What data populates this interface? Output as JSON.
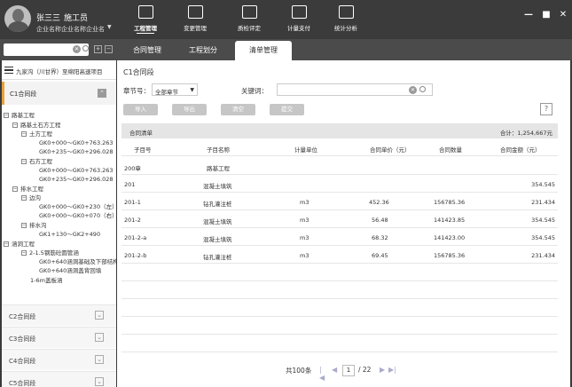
{
  "user": {
    "name": "张三三",
    "role": "施工员",
    "org": "企业名称企业名称企业名"
  },
  "topnav": [
    {
      "label": "工程管理",
      "icon": "project-icon",
      "active": true
    },
    {
      "label": "变更管理",
      "icon": "change-icon",
      "active": false
    },
    {
      "label": "质检评定",
      "icon": "quality-icon",
      "active": false
    },
    {
      "label": "计量支付",
      "icon": "payment-icon",
      "active": false
    },
    {
      "label": "统计分析",
      "icon": "stats-icon",
      "active": false
    }
  ],
  "subtabs": [
    "合同管理",
    "工程划分",
    "清单管理"
  ],
  "sidebar": {
    "project": "九家沟（川甘界）至绵阳高速项目",
    "active_contract": "C1合同段",
    "tree": [
      "路基工程",
      "路基土石方工程",
      "土方工程",
      "GK0+000～GK0+763.263",
      "GK0+235～GK0+296.028",
      "石方工程",
      "GK0+000～GK0+763.263",
      "GK0+235～GK0+296.028",
      "排水工程",
      "边沟",
      "GK0+000～GK0+230（左）",
      "GK0+000～GK0+070（右）",
      "排水沟",
      "GK1+130～GK2+490",
      "涵洞工程",
      "2-1.5钢筋砼圆管涵",
      "GK0+640涵洞基础及下部结构",
      "GK0+640涵洞盖背回填",
      "1-6m盖板涵"
    ],
    "contracts": [
      "C2合同段",
      "C3合同段",
      "C4合同段",
      "C5合同段"
    ]
  },
  "main": {
    "title": "C1合同段",
    "chapter_label": "章节号：",
    "chapter_value": "全部章节",
    "keyword_label": "关键词：",
    "buttons": [
      "导入",
      "导出",
      "清空",
      "提交"
    ],
    "help": "?",
    "table_title": "合同清单",
    "total": "合计：1,254,667元",
    "columns": [
      "子目号",
      "子目名称",
      "计量单位",
      "合同单价（元）",
      "合同数量",
      "合同金额（元）"
    ],
    "rows": [
      [
        "200章",
        "路基工程",
        "",
        "",
        "",
        ""
      ],
      [
        "201",
        "混凝土填筑",
        "",
        "",
        "",
        "354.545"
      ],
      [
        "201-1",
        "钻孔灌注桩",
        "m3",
        "452.36",
        "156785.36",
        "231.434"
      ],
      [
        "201-2",
        "混凝土填筑",
        "m3",
        "56.48",
        "141423.85",
        "354.545"
      ],
      [
        "201-2-a",
        "混凝土填筑",
        "m3",
        "68.32",
        "141423.00",
        "354.545"
      ],
      [
        "201-2-b",
        "钻孔灌注桩",
        "m3",
        "69.45",
        "156785.36",
        "231.434"
      ]
    ],
    "pager": {
      "total": "共100条",
      "page": "1",
      "of": "/ 22"
    }
  }
}
